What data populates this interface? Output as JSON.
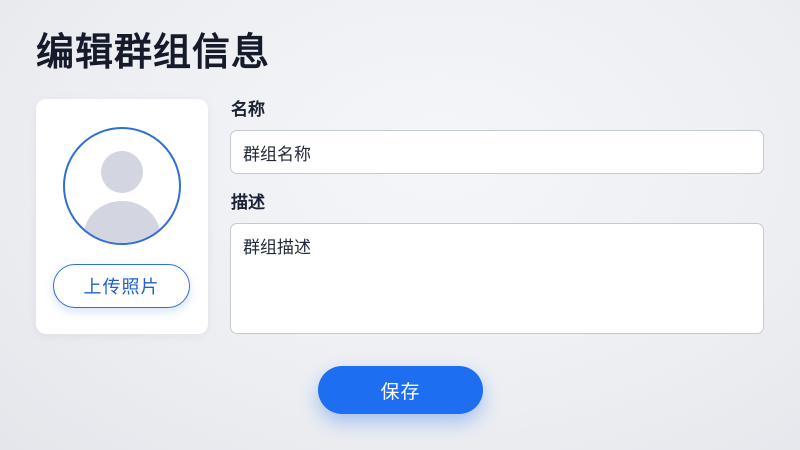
{
  "header": {
    "title": "编辑群组信息"
  },
  "avatar": {
    "icon": "user-placeholder-icon",
    "upload_label": "上传照片"
  },
  "form": {
    "name_label": "名称",
    "name_value": "群组名称",
    "description_label": "描述",
    "description_value": "群组描述"
  },
  "actions": {
    "save_label": "保存"
  },
  "colors": {
    "accent": "#1d6ef0",
    "accent_outline": "#2f6fd8",
    "avatar_placeholder": "#d3d6e0"
  }
}
